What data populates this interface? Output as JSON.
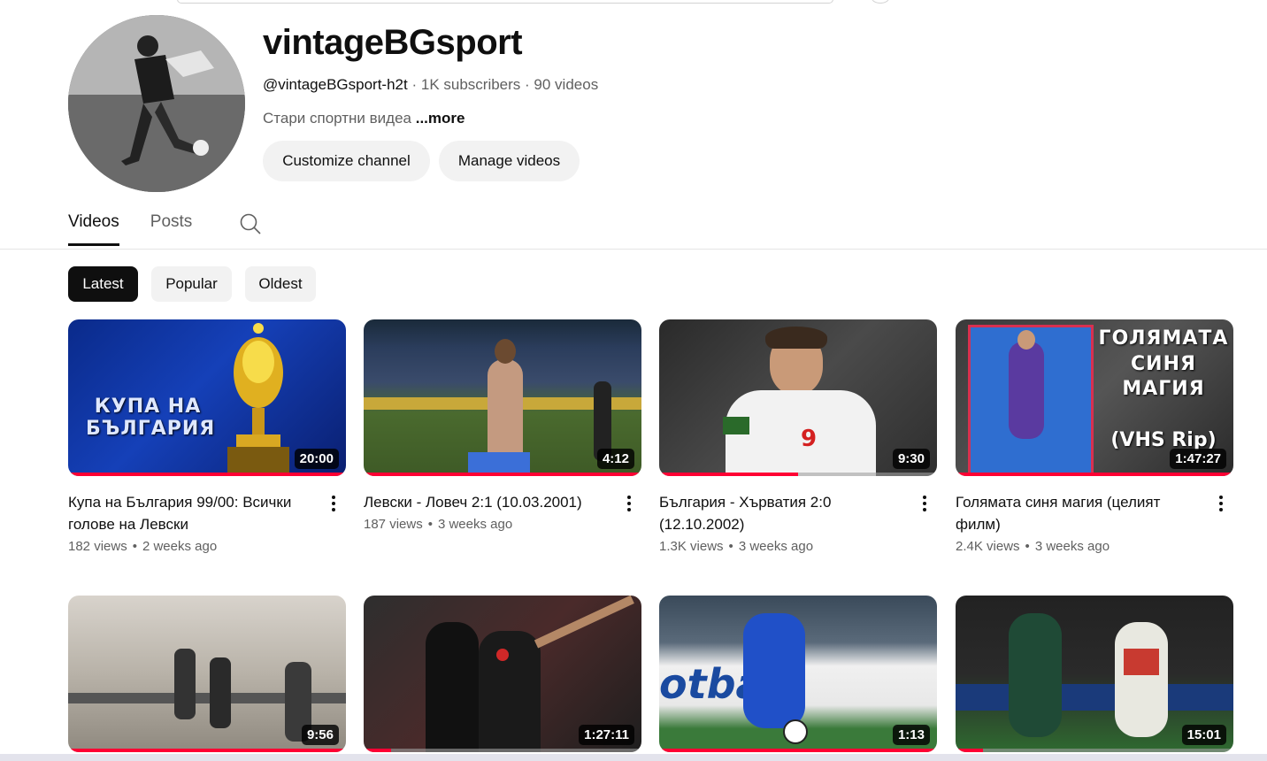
{
  "channel": {
    "name": "vintageBGsport",
    "handle": "@vintageBGsport-h2t",
    "subscribers": "1K subscribers",
    "videos_count": "90 videos",
    "description": "Стари спортни видеа",
    "more_label": "...more",
    "customize_label": "Customize channel",
    "manage_label": "Manage videos"
  },
  "tabs": [
    "Videos",
    "Posts"
  ],
  "chips": [
    "Latest",
    "Popular",
    "Oldest"
  ],
  "videos": [
    {
      "title": "Купа на България 99/00: Всички голове на Левски",
      "views": "182 views",
      "age": "2 weeks ago",
      "duration": "20:00",
      "thumb_text": "КУПА НА БЪЛГАРИЯ",
      "progress": 1.0
    },
    {
      "title": "Левски - Ловеч 2:1 (10.03.2001)",
      "views": "187 views",
      "age": "3 weeks ago",
      "duration": "4:12",
      "thumb_text": "",
      "progress": 1.0
    },
    {
      "title": "България - Хърватия 2:0 (12.10.2002)",
      "views": "1.3K views",
      "age": "3 weeks ago",
      "duration": "9:30",
      "thumb_text": "",
      "progress": 0.5
    },
    {
      "title": "Голямата синя магия (целият филм)",
      "views": "2.4K views",
      "age": "3 weeks ago",
      "duration": "1:47:27",
      "thumb_text": "ГОЛЯМАТА СИНЯ МАГИЯ",
      "thumb_text2": "(VHS Rip)",
      "progress": 1.0
    },
    {
      "title": "",
      "views": "",
      "age": "",
      "duration": "9:56",
      "thumb_text": "",
      "progress": 1.0
    },
    {
      "title": "",
      "views": "",
      "age": "",
      "duration": "1:27:11",
      "thumb_text": "",
      "progress": 0.1
    },
    {
      "title": "",
      "views": "",
      "age": "",
      "duration": "1:13",
      "thumb_text": "",
      "progress": 1.0
    },
    {
      "title": "",
      "views": "",
      "age": "",
      "duration": "15:01",
      "thumb_text": "",
      "progress": 0.1
    }
  ],
  "colors": {
    "accent": "#ff0033",
    "chip_active": "#0f0f0f",
    "chip_bg": "#f2f2f2"
  }
}
